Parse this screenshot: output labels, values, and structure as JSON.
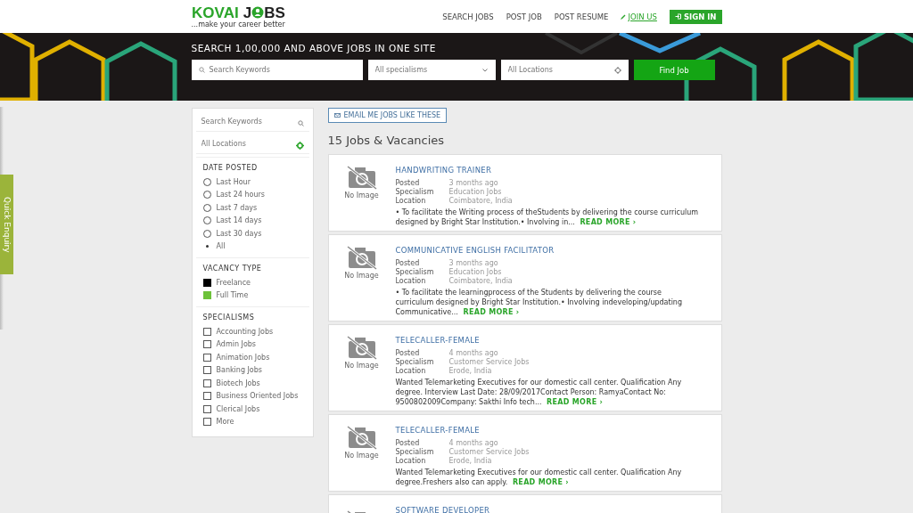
{
  "header": {
    "logo": {
      "word1": "KOVAI",
      "word2_start": "J",
      "word2_end": "BS",
      "tagline": "...make your career better"
    },
    "nav": [
      "SEARCH JOBS",
      "POST JOB",
      "POST RESUME"
    ],
    "join": "JOIN US",
    "sign_in": "SIGN IN"
  },
  "banner": {
    "headline": "SEARCH 1,00,000 AND ABOVE JOBS IN ONE SITE",
    "keywords_placeholder": "Search Keywords",
    "specialism_placeholder": "All specialisms",
    "location_placeholder": "All Locations",
    "button": "Find Job"
  },
  "quick_enquiry": "Quick Enquiry",
  "sidebar": {
    "keywords_placeholder": "Search Keywords",
    "location_placeholder": "All Locations",
    "date_posted": {
      "title": "DATE POSTED",
      "options": [
        {
          "label": "Last Hour",
          "selected": false
        },
        {
          "label": "Last 24 hours",
          "selected": false
        },
        {
          "label": "Last 7 days",
          "selected": false
        },
        {
          "label": "Last 14 days",
          "selected": false
        },
        {
          "label": "Last 30 days",
          "selected": false
        },
        {
          "label": "All",
          "selected": true
        }
      ]
    },
    "vacancy_type": {
      "title": "VACANCY TYPE",
      "options": [
        {
          "label": "Freelance",
          "color": "#000000"
        },
        {
          "label": "Full Time",
          "color": "#6dc23a"
        }
      ]
    },
    "specialisms": {
      "title": "SPECIALISMS",
      "options": [
        {
          "label": "Accounting Jobs",
          "checked": false
        },
        {
          "label": "Admin Jobs",
          "checked": false
        },
        {
          "label": "Animation Jobs",
          "checked": false
        },
        {
          "label": "Banking Jobs",
          "checked": false
        },
        {
          "label": "Biotech Jobs",
          "checked": false
        },
        {
          "label": "Business Oriented Jobs",
          "checked": false
        },
        {
          "label": "Clerical Jobs",
          "checked": false
        },
        {
          "label": "More",
          "checked": false
        }
      ]
    }
  },
  "results": {
    "email_button": "EMAIL ME JOBS LIKE THESE",
    "heading": "15 Jobs & Vacancies",
    "jobs": [
      {
        "image_label": "No Image",
        "title": "HANDWRITING TRAINER",
        "posted_label": "Posted",
        "posted": "3 months ago",
        "specialism_label": "Specialism",
        "specialism": "Education Jobs",
        "location_label": "Location",
        "location": "Coimbatore, India",
        "description": "• To facilitate the Writing process of theStudents by delivering the course curriculum designed   by Bright Star Institution.• Involving in...",
        "read_more": "READ MORE  ›"
      },
      {
        "image_label": "No Image",
        "title": "COMMUNICATIVE ENGLISH FACILITATOR",
        "posted_label": "Posted",
        "posted": "3 months ago",
        "specialism_label": "Specialism",
        "specialism": "Education Jobs",
        "location_label": "Location",
        "location": "Coimbatore, India",
        "description": "• To facilitate the learningprocess of the Students by delivering the course curriculum designed by Bright Star Institution.• Involving indeveloping/updating Communicative...",
        "read_more": "READ MORE  ›"
      },
      {
        "image_label": "No Image",
        "title": "TELECALLER-FEMALE",
        "posted_label": "Posted",
        "posted": "4 months ago",
        "specialism_label": "Specialism",
        "specialism": "Customer Service Jobs",
        "location_label": "Location",
        "location": "Erode, India",
        "description": "Wanted Telemarketing Executives for our domestic call center. Qualification Any degree. Interview Last Date: 28/09/2017Contact Person: RamyaContact No: 9500802009Company: Sakthi Info tech...",
        "read_more": "READ MORE  ›"
      },
      {
        "image_label": "No Image",
        "title": "TELECALLER-FEMALE",
        "posted_label": "Posted",
        "posted": "4 months ago",
        "specialism_label": "Specialism",
        "specialism": "Customer Service Jobs",
        "location_label": "Location",
        "location": "Erode, India",
        "description": "Wanted Telemarketing Executives for our domestic call center. Qualification Any degree.Freshers also can apply.",
        "read_more": "READ MORE  ›"
      },
      {
        "title": "SOFTWARE DEVELOPER"
      }
    ]
  }
}
